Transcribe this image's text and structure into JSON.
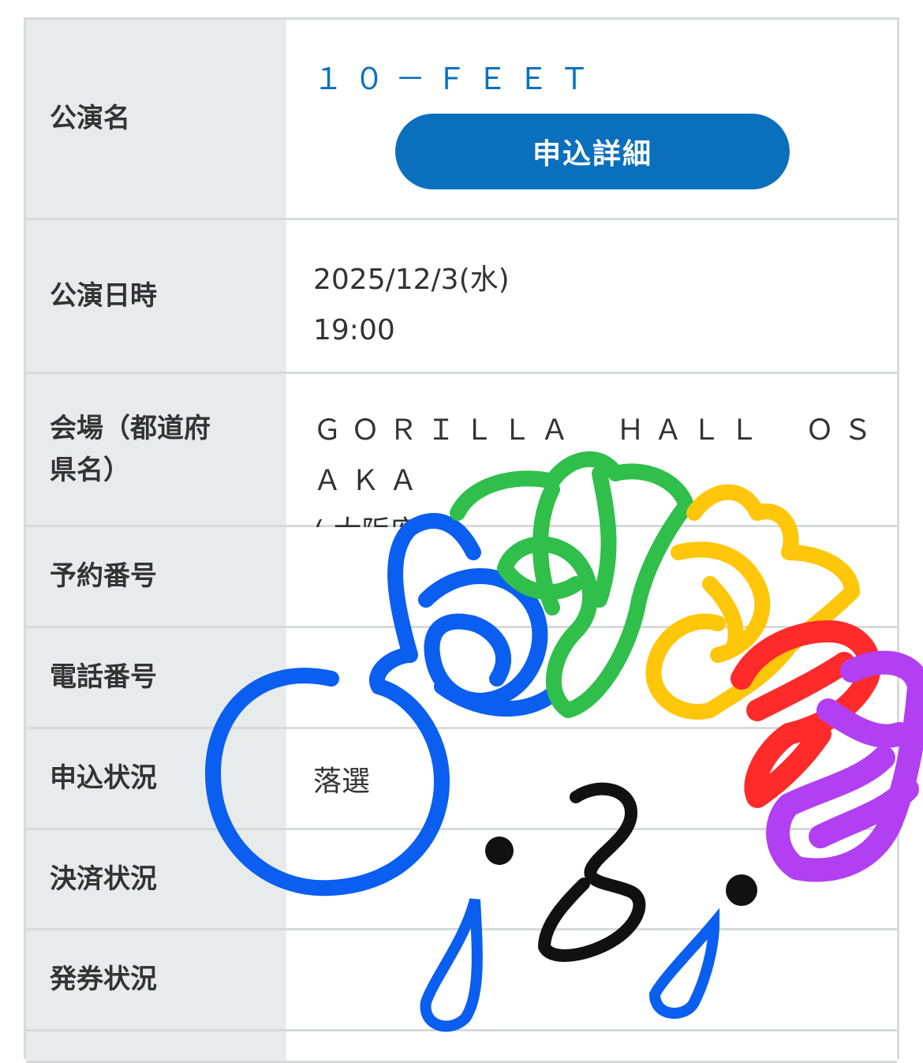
{
  "rows": {
    "performance_name": {
      "label": "公演名",
      "value": "１０－ＦＥＥＴ",
      "button": "申込詳細"
    },
    "datetime": {
      "label": "公演日時",
      "date": "2025/12/3(水)",
      "time": "19:00"
    },
    "venue": {
      "label_line1": "会場（都道府",
      "label_line2": "県名）",
      "name": "ＧＯＲＩＬＬＡ　ＨＡＬＬ　ＯＳＡＫＡ",
      "prefecture": "( 大阪府 )"
    },
    "reservation_number": {
      "label": "予約番号",
      "value": ""
    },
    "phone_number": {
      "label": "電話番号",
      "value": ""
    },
    "application_status": {
      "label": "申込状況",
      "value": "落選"
    },
    "payment_status": {
      "label": "決済状況",
      "value": ""
    },
    "ticket_status": {
      "label": "発券状況",
      "value": ""
    }
  },
  "colors": {
    "accent": "#0a6fbd",
    "header_bg": "#e8ebec",
    "border": "#d6dadb",
    "doodle_blue": "#0a5ef0",
    "doodle_green": "#2fbf4a",
    "doodle_yellow": "#ffc60a",
    "doodle_red": "#ff2a2a",
    "doodle_purple": "#b23ff2",
    "doodle_black": "#111111"
  }
}
